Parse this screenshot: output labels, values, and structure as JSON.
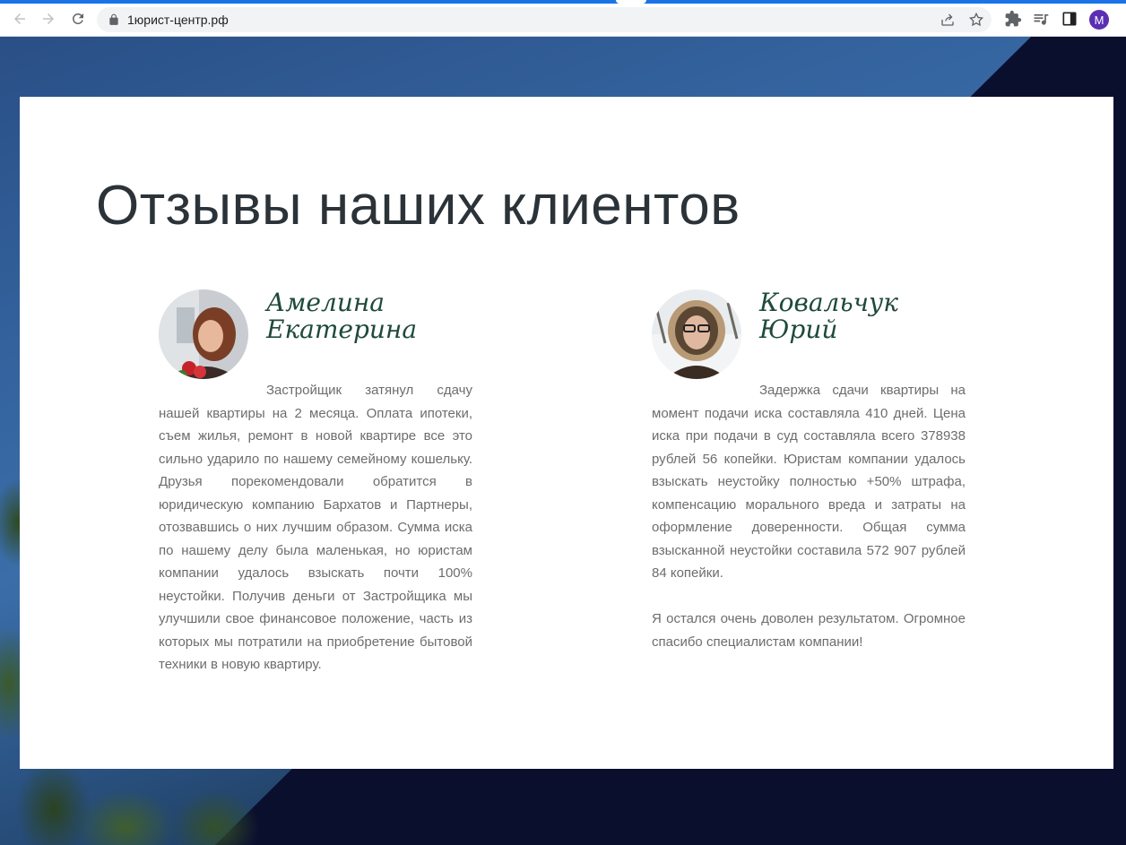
{
  "browser": {
    "url": "1юрист-центр.рф",
    "avatar_letter": "M",
    "accent_color": "#1a73e8",
    "icons": [
      "back-arrow-icon",
      "forward-arrow-icon",
      "reload-icon",
      "lock-icon",
      "share-icon",
      "star-icon",
      "extensions-icon",
      "media-icon",
      "side-panel-icon"
    ]
  },
  "page": {
    "heading": "Отзывы наших клиентов",
    "reviews": [
      {
        "name_line1": "Амелина",
        "name_line2": "Екатерина",
        "paragraphs": [
          "Застройщик затянул сдачу нашей квартиры на 2 месяца. Оплата ипотеки, съем жилья, ремонт в новой квартире все это сильно ударило по нашему семейному кошельку. Друзья порекомендовали обратится в юридическую компанию Бархатов и Партнеры, отозвавшись о них лучшим образом. Сумма иска по нашему делу была маленькая, но юристам компании удалось взыскать почти 100% неустойки. Получив деньги от Застройщика мы улучшили свое финансовое положение, часть из которых мы потратили на приобретение бытовой техники в новую квартиру."
        ]
      },
      {
        "name_line1": "Ковальчук",
        "name_line2": "Юрий",
        "paragraphs": [
          "Задержка сдачи квартиры на момент подачи иска составляла 410 дней. Цена иска при подачи в суд составляла всего 378938 рублей 56 копейки. Юристам компании удалось взыскать неустойку полностью +50% штрафа, компенсацию морального вреда и затраты на оформление доверенности. Общая сумма взысканной неустойки составила 572 907 рублей 84 копейки.",
          "Я остался очень доволен результатом. Огромное спасибо специалистам компании!"
        ]
      }
    ]
  }
}
